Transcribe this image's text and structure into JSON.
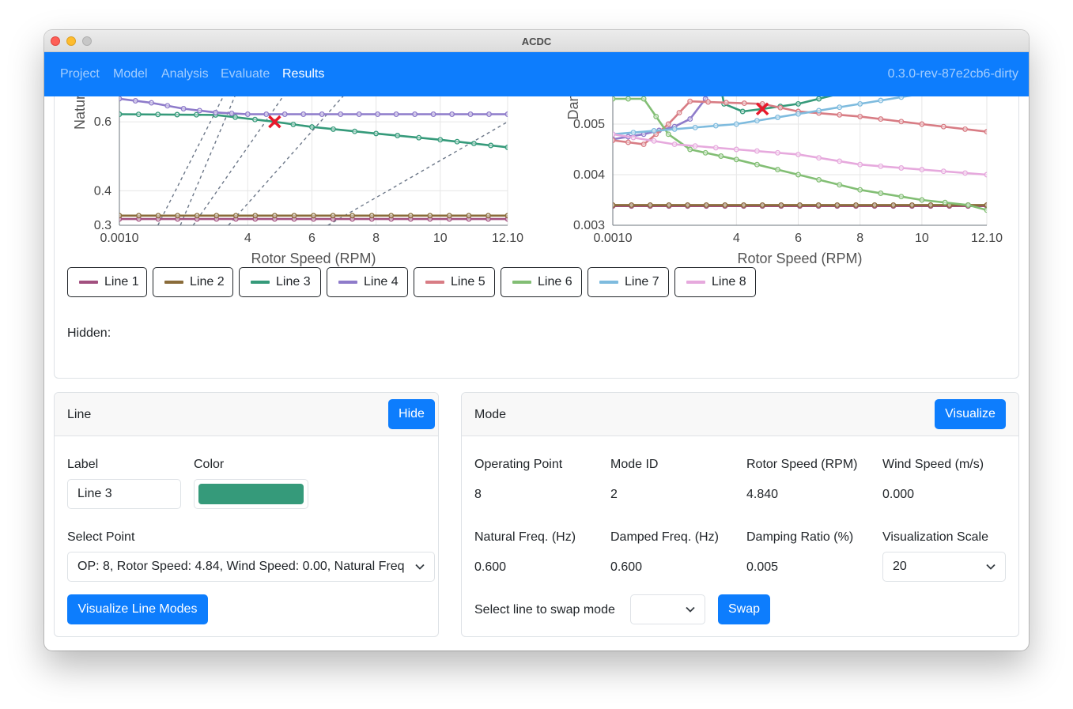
{
  "window": {
    "title": "ACDC"
  },
  "nav": {
    "items": [
      {
        "label": "Project",
        "active": false
      },
      {
        "label": "Model",
        "active": false
      },
      {
        "label": "Analysis",
        "active": false
      },
      {
        "label": "Evaluate",
        "active": false
      },
      {
        "label": "Results",
        "active": true
      }
    ],
    "version": "0.3.0-rev-87e2cb6-dirty"
  },
  "icons": {
    "close": "close-dot",
    "minimize": "minimize-dot",
    "zoom": "zoom-dot",
    "chevron": "chevron-down-icon",
    "marker": "x-marker-icon"
  },
  "chart_data": [
    {
      "type": "line",
      "ylabel": "Natural",
      "xlabel": "Rotor Speed (RPM)",
      "xlim": [
        0.001,
        12.1
      ],
      "ylim": [
        0.3,
        0.74
      ],
      "xtick_labels": [
        {
          "v": 0.001,
          "label": "0.0010"
        },
        {
          "v": 4,
          "label": "4"
        },
        {
          "v": 6,
          "label": "6"
        },
        {
          "v": 8,
          "label": "8"
        },
        {
          "v": 10,
          "label": "10"
        },
        {
          "v": 12.1,
          "label": "12.10"
        }
      ],
      "ytick_labels": [
        {
          "v": 0.3,
          "label": "0.3"
        },
        {
          "v": 0.4,
          "label": "0.4"
        },
        {
          "v": 0.6,
          "label": "0.6"
        }
      ],
      "dashed_lines": [
        [
          [
            1.2,
            0.3
          ],
          [
            3.6,
            0.74
          ]
        ],
        [
          [
            1.9,
            0.3
          ],
          [
            3.9,
            0.74
          ]
        ],
        [
          [
            2.3,
            0.3
          ],
          [
            5.6,
            0.74
          ]
        ],
        [
          [
            3.4,
            0.3
          ],
          [
            7.6,
            0.74
          ]
        ],
        [
          [
            6.5,
            0.3
          ],
          [
            12.1,
            0.6
          ]
        ]
      ],
      "marker": {
        "x": 4.84,
        "y": 0.6
      },
      "series": [
        {
          "name": "Line 1",
          "color": "#a2507f",
          "points": [
            [
              0.001,
              0.318
            ],
            [
              12.1,
              0.318
            ]
          ]
        },
        {
          "name": "Line 2",
          "color": "#8a6c3a",
          "points": [
            [
              0.001,
              0.328
            ],
            [
              12.1,
              0.328
            ]
          ]
        },
        {
          "name": "Line 3",
          "color": "#359a7a",
          "points": [
            [
              0.001,
              0.622
            ],
            [
              3.0,
              0.62
            ],
            [
              4.84,
              0.6
            ],
            [
              6.0,
              0.585
            ],
            [
              8.0,
              0.566
            ],
            [
              10.0,
              0.548
            ],
            [
              12.1,
              0.526
            ]
          ]
        },
        {
          "name": "Line 4",
          "color": "#8e7bca",
          "points": [
            [
              0.001,
              0.667
            ],
            [
              1.0,
              0.655
            ],
            [
              2.0,
              0.638
            ],
            [
              3.0,
              0.627
            ],
            [
              4.0,
              0.622
            ],
            [
              12.1,
              0.622
            ]
          ]
        },
        {
          "name": "Line 5",
          "color": "#d87c84",
          "points": [
            [
              0.001,
              0.68
            ],
            [
              2.0,
              0.695
            ],
            [
              4.0,
              0.704
            ],
            [
              6.0,
              0.71
            ],
            [
              8.0,
              0.713
            ],
            [
              12.1,
              0.718
            ]
          ]
        },
        {
          "name": "Line 6",
          "color": "#82be74",
          "points": [
            [
              0.001,
              0.697
            ],
            [
              1.0,
              0.697
            ],
            [
              2.0,
              0.7
            ],
            [
              3.0,
              0.72
            ],
            [
              3.5,
              0.74
            ]
          ]
        }
      ]
    },
    {
      "type": "line",
      "ylabel": "Dan",
      "xlabel": "Rotor Speed (RPM)",
      "xlim": [
        0.001,
        12.1
      ],
      "ylim": [
        0.003,
        0.006
      ],
      "xtick_labels": [
        {
          "v": 0.001,
          "label": "0.0010"
        },
        {
          "v": 4,
          "label": "4"
        },
        {
          "v": 6,
          "label": "6"
        },
        {
          "v": 8,
          "label": "8"
        },
        {
          "v": 10,
          "label": "10"
        },
        {
          "v": 12.1,
          "label": "12.10"
        }
      ],
      "ytick_labels": [
        {
          "v": 0.003,
          "label": "0.003"
        },
        {
          "v": 0.004,
          "label": "0.004"
        },
        {
          "v": 0.005,
          "label": "0.005"
        },
        {
          "v": 0.006,
          "label": "0.006"
        }
      ],
      "marker": {
        "x": 4.84,
        "y": 0.0053
      },
      "series": [
        {
          "name": "Line 1",
          "color": "#a2507f",
          "points": [
            [
              0.001,
              0.00338
            ],
            [
              12.1,
              0.00338
            ]
          ]
        },
        {
          "name": "Line 2",
          "color": "#8a6c3a",
          "points": [
            [
              0.001,
              0.0034
            ],
            [
              12.1,
              0.0034
            ]
          ]
        },
        {
          "name": "Line 3",
          "color": "#359a7a",
          "points": [
            [
              3.3,
              0.0063
            ],
            [
              3.6,
              0.0054
            ],
            [
              4.2,
              0.00525
            ],
            [
              4.84,
              0.0053
            ],
            [
              6.0,
              0.0054
            ],
            [
              8.0,
              0.0057
            ],
            [
              10.0,
              0.0059
            ],
            [
              12.1,
              0.0061
            ]
          ]
        },
        {
          "name": "Line 4",
          "color": "#8e7bca",
          "points": [
            [
              0.001,
              0.0047
            ],
            [
              1.0,
              0.0048
            ],
            [
              2.0,
              0.00495
            ],
            [
              2.5,
              0.0051
            ],
            [
              3.0,
              0.0055
            ],
            [
              3.3,
              0.0063
            ]
          ]
        },
        {
          "name": "Line 5",
          "color": "#d87c84",
          "points": [
            [
              0.001,
              0.00468
            ],
            [
              1.0,
              0.0046
            ],
            [
              1.8,
              0.005
            ],
            [
              2.5,
              0.00545
            ],
            [
              4.84,
              0.0054
            ],
            [
              6.0,
              0.00525
            ],
            [
              8.0,
              0.00515
            ],
            [
              10.0,
              0.005
            ],
            [
              12.1,
              0.00485
            ]
          ]
        },
        {
          "name": "Line 6",
          "color": "#82be74",
          "points": [
            [
              0.001,
              0.0055
            ],
            [
              1.0,
              0.0055
            ],
            [
              1.8,
              0.0048
            ],
            [
              2.5,
              0.0045
            ],
            [
              4.0,
              0.0043
            ],
            [
              6.0,
              0.004
            ],
            [
              8.0,
              0.0037
            ],
            [
              10.0,
              0.0035
            ],
            [
              11.5,
              0.0034
            ],
            [
              12.1,
              0.0033
            ]
          ]
        },
        {
          "name": "Line 7",
          "color": "#7ebbde",
          "points": [
            [
              0.001,
              0.0048
            ],
            [
              2.0,
              0.0049
            ],
            [
              4.0,
              0.005
            ],
            [
              6.0,
              0.0052
            ],
            [
              8.0,
              0.0054
            ],
            [
              10.0,
              0.0056
            ],
            [
              11.5,
              0.0057
            ],
            [
              12.1,
              0.00575
            ]
          ]
        },
        {
          "name": "Line 8",
          "color": "#e6a9dd",
          "points": [
            [
              0.001,
              0.0048
            ],
            [
              2.0,
              0.0046
            ],
            [
              4.0,
              0.0045
            ],
            [
              6.0,
              0.0044
            ],
            [
              8.0,
              0.0042
            ],
            [
              10.0,
              0.0041
            ],
            [
              12.1,
              0.004
            ]
          ]
        }
      ]
    }
  ],
  "legend": {
    "buttons": [
      {
        "label": "Line 1",
        "color": "#a2507f"
      },
      {
        "label": "Line 2",
        "color": "#8a6c3a"
      },
      {
        "label": "Line 3",
        "color": "#359a7a"
      },
      {
        "label": "Line 4",
        "color": "#8e7bca"
      },
      {
        "label": "Line 5",
        "color": "#d87c84"
      },
      {
        "label": "Line 6",
        "color": "#82be74"
      },
      {
        "label": "Line 7",
        "color": "#7ebbde"
      },
      {
        "label": "Line 8",
        "color": "#e6a9dd"
      }
    ],
    "hidden_label": "Hidden:"
  },
  "line_panel": {
    "title": "Line",
    "hide_button": "Hide",
    "label_field": {
      "label": "Label",
      "value": "Line 3"
    },
    "color_field": {
      "label": "Color",
      "value": "#359a7a"
    },
    "select_point": {
      "label": "Select Point",
      "value": "OP: 8, Rotor Speed: 4.84, Wind Speed: 0.00, Natural Freq"
    },
    "visualize_button": "Visualize Line Modes"
  },
  "mode_panel": {
    "title": "Mode",
    "visualize_button": "Visualize",
    "fields": [
      {
        "label": "Operating Point",
        "value": "8"
      },
      {
        "label": "Mode ID",
        "value": "2"
      },
      {
        "label": "Rotor Speed (RPM)",
        "value": "4.840"
      },
      {
        "label": "Wind Speed (m/s)",
        "value": "0.000"
      },
      {
        "label": "Natural Freq. (Hz)",
        "value": "0.600"
      },
      {
        "label": "Damped Freq. (Hz)",
        "value": "0.600"
      },
      {
        "label": "Damping Ratio (%)",
        "value": "0.005"
      },
      {
        "label": "Visualization Scale",
        "value": "20"
      }
    ],
    "swap_label": "Select line to swap mode",
    "swap_select_value": "",
    "swap_button": "Swap"
  }
}
